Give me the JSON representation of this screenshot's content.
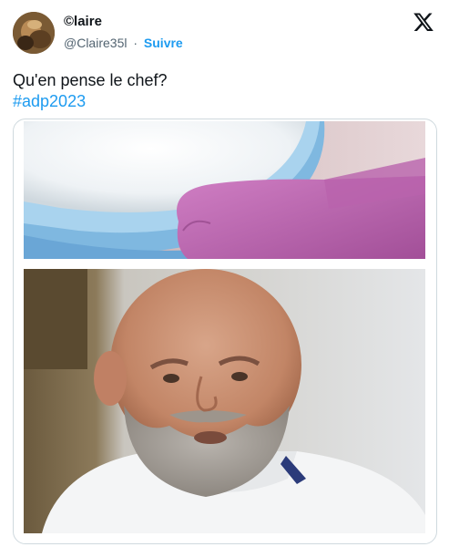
{
  "author": {
    "display_name": "©laire",
    "handle": "@Claire35l",
    "separator": "·",
    "follow_label": "Suivre"
  },
  "tweet": {
    "text": "Qu'en pense le chef?",
    "hashtag": "#adp2023"
  },
  "icons": {
    "platform_logo": "x-logo-icon",
    "avatar": "avatar"
  },
  "colors": {
    "link": "#1d9bf0",
    "text": "#0f1419",
    "secondary": "#536471",
    "border": "#cfd9de"
  }
}
